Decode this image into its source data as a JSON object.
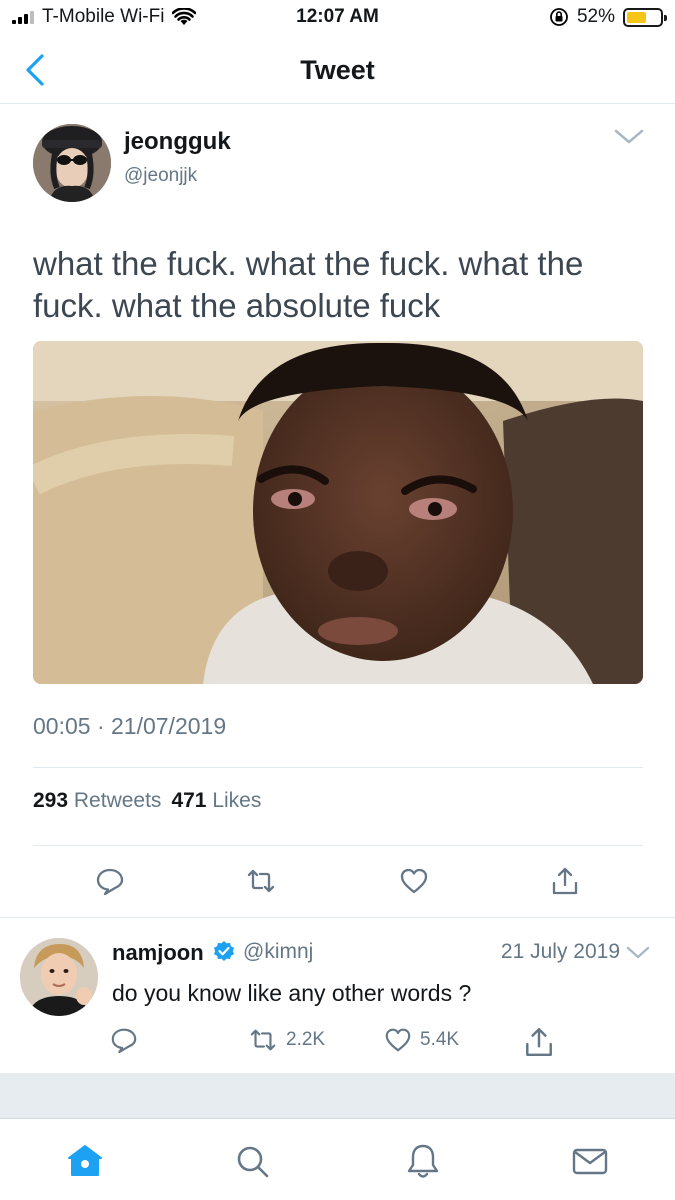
{
  "status_bar": {
    "carrier": "T-Mobile Wi-Fi",
    "time": "12:07 AM",
    "battery": "52%"
  },
  "nav": {
    "title": "Tweet"
  },
  "tweet": {
    "author_name": "jeongguk",
    "author_handle": "@jeonjjk",
    "text": "what the fuck. what the fuck. what the fuck. what the absolute fuck",
    "timestamp": "00:05 · 21/07/2019",
    "retweets_count": "293",
    "retweets_label": "Retweets",
    "likes_count": "471",
    "likes_label": "Likes"
  },
  "reply": {
    "author_name": "namjoon",
    "author_handle": "@kimnj",
    "date": "21 July 2019",
    "text": "do you know like any other words ?",
    "retweet_count": "2.2K",
    "like_count": "5.4K"
  },
  "tabs": [
    "home",
    "search",
    "notifications",
    "messages"
  ],
  "colors": {
    "accent": "#1da1f2",
    "muted": "#657786",
    "battery": "#f5c518",
    "verified": "#1da1f2"
  }
}
